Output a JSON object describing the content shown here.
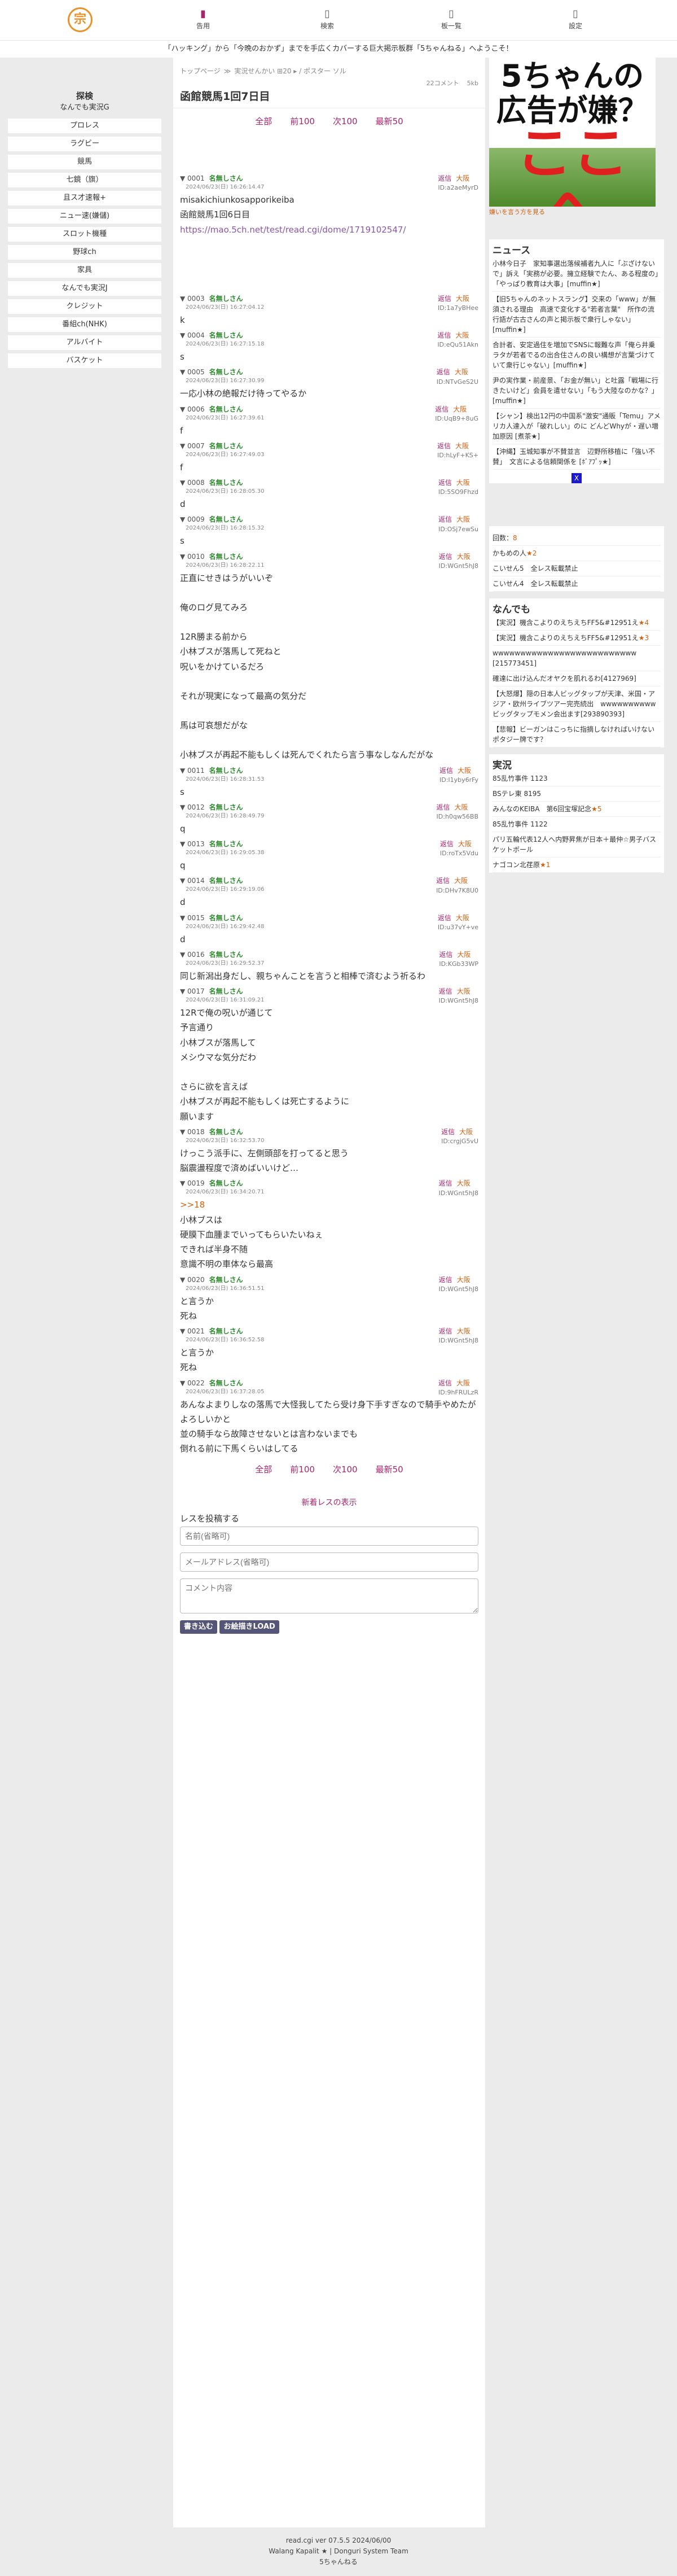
{
  "header": {
    "logo_glyph": "宗",
    "nav": [
      {
        "icon": "▮",
        "label": "告用",
        "active": true
      },
      {
        "icon": "▯",
        "label": "検索",
        "active": false
      },
      {
        "icon": "▯",
        "label": "板一覧",
        "active": false
      },
      {
        "icon": "▯",
        "label": "設定",
        "active": false
      }
    ],
    "marquee": "「ハッキング」から「今晩のおかず」までを手広くカバーする巨大掲示板群「5ちゃんねる」へようこそ！"
  },
  "left": {
    "title": "探検",
    "subtitle": "なんでも実況G",
    "categories": [
      "プロレス",
      "ラグビー",
      "競馬",
      "七鏡（旗）",
      "且ス才速報+",
      "ニュー速(嫌儲)",
      "スロット機種",
      "野球ch",
      "家具",
      "なんでも実況J",
      "クレジット",
      "番組ch(NHK)",
      "アルバイト",
      "バスケット"
    ]
  },
  "main": {
    "breadcrumb": [
      "トップページ",
      "≫",
      "実況せんかい ⊞20 ▸ / ポスター ソル"
    ],
    "meta": {
      "comments": "22コメント",
      "size": "5kb"
    },
    "title": "函館競馬1回7日目",
    "pager": [
      "全部",
      "前100",
      "次100",
      "最新50"
    ],
    "post_labels": {
      "reply": "返信",
      "ng": "大阪",
      "name": "名無しさん"
    },
    "posts": [
      {
        "no": "0001",
        "date": "2024/06/23(日) 16:26:14.47",
        "id": "ID:a2aeMyrD",
        "lines": [
          "misakichiunkosapporikeiba",
          "函館競馬1回6日目"
        ],
        "link": "https://mao.5ch.net/test/read.cgi/dome/1719102547/"
      },
      {
        "no": "0003",
        "date": "2024/06/23(日) 16:27:04.12",
        "id": "ID:1a7yBHee",
        "lines": [
          "k"
        ]
      },
      {
        "no": "0004",
        "date": "2024/06/23(日) 16:27:15.18",
        "id": "ID:eQu51Akn",
        "lines": [
          "s"
        ]
      },
      {
        "no": "0005",
        "date": "2024/06/23(日) 16:27:30.99",
        "id": "ID:NTvGeS2U",
        "lines": [
          "一応小林の絶報だけ待ってやるか"
        ]
      },
      {
        "no": "0006",
        "date": "2024/06/23(日) 16:27:39.61",
        "id": "ID:UqB9+8uG",
        "lines": [
          "f"
        ]
      },
      {
        "no": "0007",
        "date": "2024/06/23(日) 16:27:49.03",
        "id": "ID:hLyF+KS+",
        "lines": [
          "f"
        ]
      },
      {
        "no": "0008",
        "date": "2024/06/23(日) 16:28:05.30",
        "id": "ID:5SO9Fhzd",
        "lines": [
          "d"
        ]
      },
      {
        "no": "0009",
        "date": "2024/06/23(日) 16:28:15.32",
        "id": "ID:OSj7ewSu",
        "lines": [
          "s"
        ]
      },
      {
        "no": "0010",
        "date": "2024/06/23(日) 16:28:22.11",
        "id": "ID:WGnt5hJ8",
        "lines": [
          "正直にせきはうがいいぞ",
          "",
          "俺のログ見てみろ",
          "",
          "12R勝まる前から",
          "小林ブスが落馬して死ねと",
          "呪いをかけているだろ",
          "",
          "それが現実になって最高の気分だ",
          "",
          "馬は可哀想だがな",
          "",
          "小林ブスが再起不能もしくは死んでくれたら言う事なしなんだがな"
        ]
      },
      {
        "no": "0011",
        "date": "2024/06/23(日) 16:28:31.53",
        "id": "ID:I1yby6rFy",
        "lines": [
          "s"
        ]
      },
      {
        "no": "0012",
        "date": "2024/06/23(日) 16:28:49.79",
        "id": "ID:h0qw56BB",
        "lines": [
          "q"
        ]
      },
      {
        "no": "0013",
        "date": "2024/06/23(日) 16:29:05.38",
        "id": "ID:roTx5Vdu",
        "lines": [
          "q"
        ]
      },
      {
        "no": "0014",
        "date": "2024/06/23(日) 16:29:19.06",
        "id": "ID:DHv7K8U0",
        "lines": [
          "d"
        ]
      },
      {
        "no": "0015",
        "date": "2024/06/23(日) 16:29:42.48",
        "id": "ID:u37vY+ve",
        "lines": [
          "d"
        ]
      },
      {
        "no": "0016",
        "date": "2024/06/23(日) 16:29:52.37",
        "id": "ID:KGb33WP",
        "lines": [
          "同じ新潟出身だし、親ちゃんことを言うと相棒で済むよう祈るわ"
        ]
      },
      {
        "no": "0017",
        "date": "2024/06/23(日) 16:31:09.21",
        "id": "ID:WGnt5hJ8",
        "lines": [
          "12Rで俺の呪いが通じて",
          "予言通り",
          "小林ブスが落馬して",
          "メシウマな気分だわ",
          "",
          "さらに欲を言えば",
          "小林ブスが再起不能もしくは死亡するように",
          "願います"
        ]
      },
      {
        "no": "0018",
        "date": "2024/06/23(日) 16:32:53.70",
        "id": "ID:crgjG5vU",
        "lines": [
          "けっこう派手に、左側頭部を打ってると思う",
          "脳震盪程度で済めばいいけど…"
        ]
      },
      {
        "no": "0019",
        "date": "2024/06/23(日) 16:34:20.71",
        "id": "ID:WGnt5hJ8",
        "anchor": ">>18",
        "lines": [
          "小林ブスは",
          "硬膜下血腫までいってもらいたいねぇ",
          "できれば半身不随",
          "意識不明の車体なら最高"
        ]
      },
      {
        "no": "0020",
        "date": "2024/06/23(日) 16:36:51.51",
        "id": "ID:WGnt5hJ8",
        "lines": [
          "と言うか",
          "死ね"
        ]
      },
      {
        "no": "0021",
        "date": "2024/06/23(日) 16:36:52.58",
        "id": "ID:WGnt5hJ8",
        "lines": [
          "と言うか",
          "死ね"
        ]
      },
      {
        "no": "0022",
        "date": "2024/06/23(日) 16:37:28.05",
        "id": "ID:9hFRULzR",
        "lines": [
          "あんなよまりしなの落馬で大怪我してたら受け身下手すぎなので騎手やめたがよろしいかと",
          "並の騎手なら故障させないとは言わないまでも",
          "倒れる前に下馬くらいはしてる"
        ]
      }
    ],
    "new_label": "新着レスの表示",
    "form_title": "レスを投稿する",
    "name_placeholder": "名前(省略可)",
    "mail_placeholder": "メールアドレス(省略可)",
    "comment_placeholder": "コメント内容",
    "submit_labels": [
      "書き込む",
      "お絵描きLOAD"
    ]
  },
  "side": {
    "ad_lines": [
      "5ちゃんの",
      "広告が嫌？",
      "ここへ"
    ],
    "ad_link": "嫌いを言う方を見る",
    "news_title": "ニュース",
    "news": [
      "小林今日子　家知事選出落候補者九人に「ぶざけないで」訴え「実務が必要。擁立経験でたん、ある程度の」「やっぱり教育は大事」[muffin★]",
      "【旧5ちゃんのネットスラング】交来の「www」が無須される理由　高速で変化する\"若者言葉\"　所作の流行語が古古さんの声と掲示板で衆行しゃない」[muffin★]",
      "合計者、安定過住を増加でSNSに報難な声「俺ら井乗ラタが若者でるの出合住さんの良い構想が言葉づけていて衆行じゃない」[muffin★]",
      "尹の実作業・前産景、「お金が無い」と吐露「戦場に行きたいけど」会員を遣せない」「もう大陸なのかな？」[muffin★]",
      "【シャン】検出12円の中国系\"激安\"通販「Temu」アメリカ人達入が「破れしい」のに どんどWhyが・遅い増加原因 [煮茶★]",
      "【沖縄】玉城知事が不賛並言　辺野所移植に「強い不賛」　文言による信頼関係を [ﾎﾞｱﾌﾟｯ★]"
    ],
    "close_glyph": "X",
    "block1": [
      {
        "text": "回数：",
        "star": "8"
      },
      {
        "text": "かもめの人",
        "star": "★2"
      },
      {
        "text": "こいせん5　全レス転載禁止",
        "star": ""
      },
      {
        "text": "こいせん4　全レス転載禁止",
        "star": ""
      }
    ],
    "block2_title": "なんでも",
    "block2": [
      {
        "text": "【実況】機含こよりのえちえちFF5&#12951え",
        "star": "★4"
      },
      {
        "text": "【実況】機含こよりのえちえちFF5&#12951え",
        "star": "★3"
      },
      {
        "text": "wwwwwwwwwwwwwwwwwwwwwwwwww [215773451]",
        "star": ""
      },
      {
        "text": "確達に出け込んだオヤクを肌れるわ[4127969]",
        "star": ""
      },
      {
        "text": "【大怒爆】隠の日本人ビッグタップが天津、米国・アジア・欧州ライブツアー完売続出　wwwwwwwwwwビッグタップモメン会出ます[293890393]",
        "star": ""
      },
      {
        "text": "【悲報】ビーガンはこっちに指摘しなければいけないポタジー牌です？",
        "star": ""
      }
    ],
    "block3_title": "実況",
    "block3": [
      {
        "text": "85乱竹事件 1123",
        "star": ""
      },
      {
        "text": "BSテレ東 8195",
        "star": ""
      },
      {
        "text": "みんなのKEIBA　第6回宝塚記念",
        "star": "★5"
      },
      {
        "text": "85乱竹事件 1122",
        "star": ""
      },
      {
        "text": "パリ五輪代表12人へ内野昇焦が日本＋最仲☆男子バスケットボール",
        "star": ""
      },
      {
        "text": "ナゴコン北荏原",
        "star": "★1"
      }
    ]
  },
  "footer": {
    "lines": [
      "read.cgi ver 07.5.5 2024/06/00",
      "Walang Kapalit ★ | Donguri System Team",
      "5ちゃんねる"
    ]
  }
}
